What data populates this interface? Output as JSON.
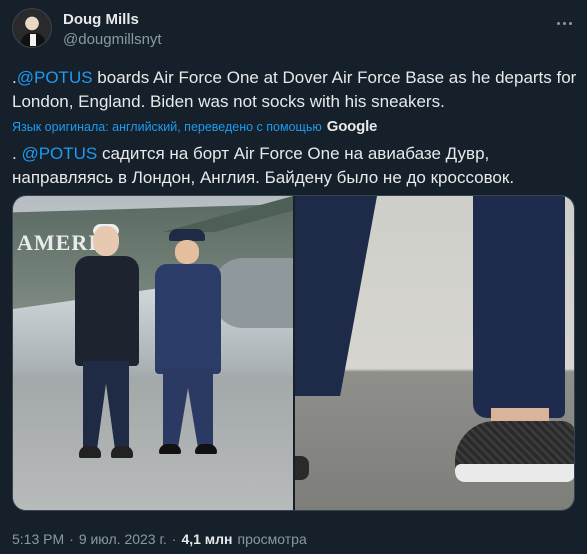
{
  "author": {
    "name": "Doug Mills",
    "handle": "@dougmillsnyt",
    "avatar_icon": "avatar-photo"
  },
  "more_icon": "more-dots-icon",
  "tweet": {
    "prefix": ".",
    "mention": "@POTUS",
    "text": " boards Air Force One at Dover Air Force Base as he departs for London, England. Biden was not socks with his sneakers."
  },
  "translation": {
    "note": "Язык оригинала: английский, переведено с помощью",
    "provider": "Google"
  },
  "translated": {
    "prefix": ". ",
    "mention": "@POTUS",
    "text": " садится на борт Air Force One на авиабазе Дувр, направляясь в Лондон, Англия. Байдену было не до кроссовок."
  },
  "media": {
    "plane_text": "AMERIC"
  },
  "meta": {
    "time": "5:13 PM",
    "sep1": "·",
    "date": "9 июл. 2023 г.",
    "sep2": "·",
    "views_count": "4,1 млн",
    "views_label": "просмотра"
  },
  "colors": {
    "background": "#15202b",
    "accent": "#1d9bf0",
    "secondary_text": "#8b98a5"
  }
}
